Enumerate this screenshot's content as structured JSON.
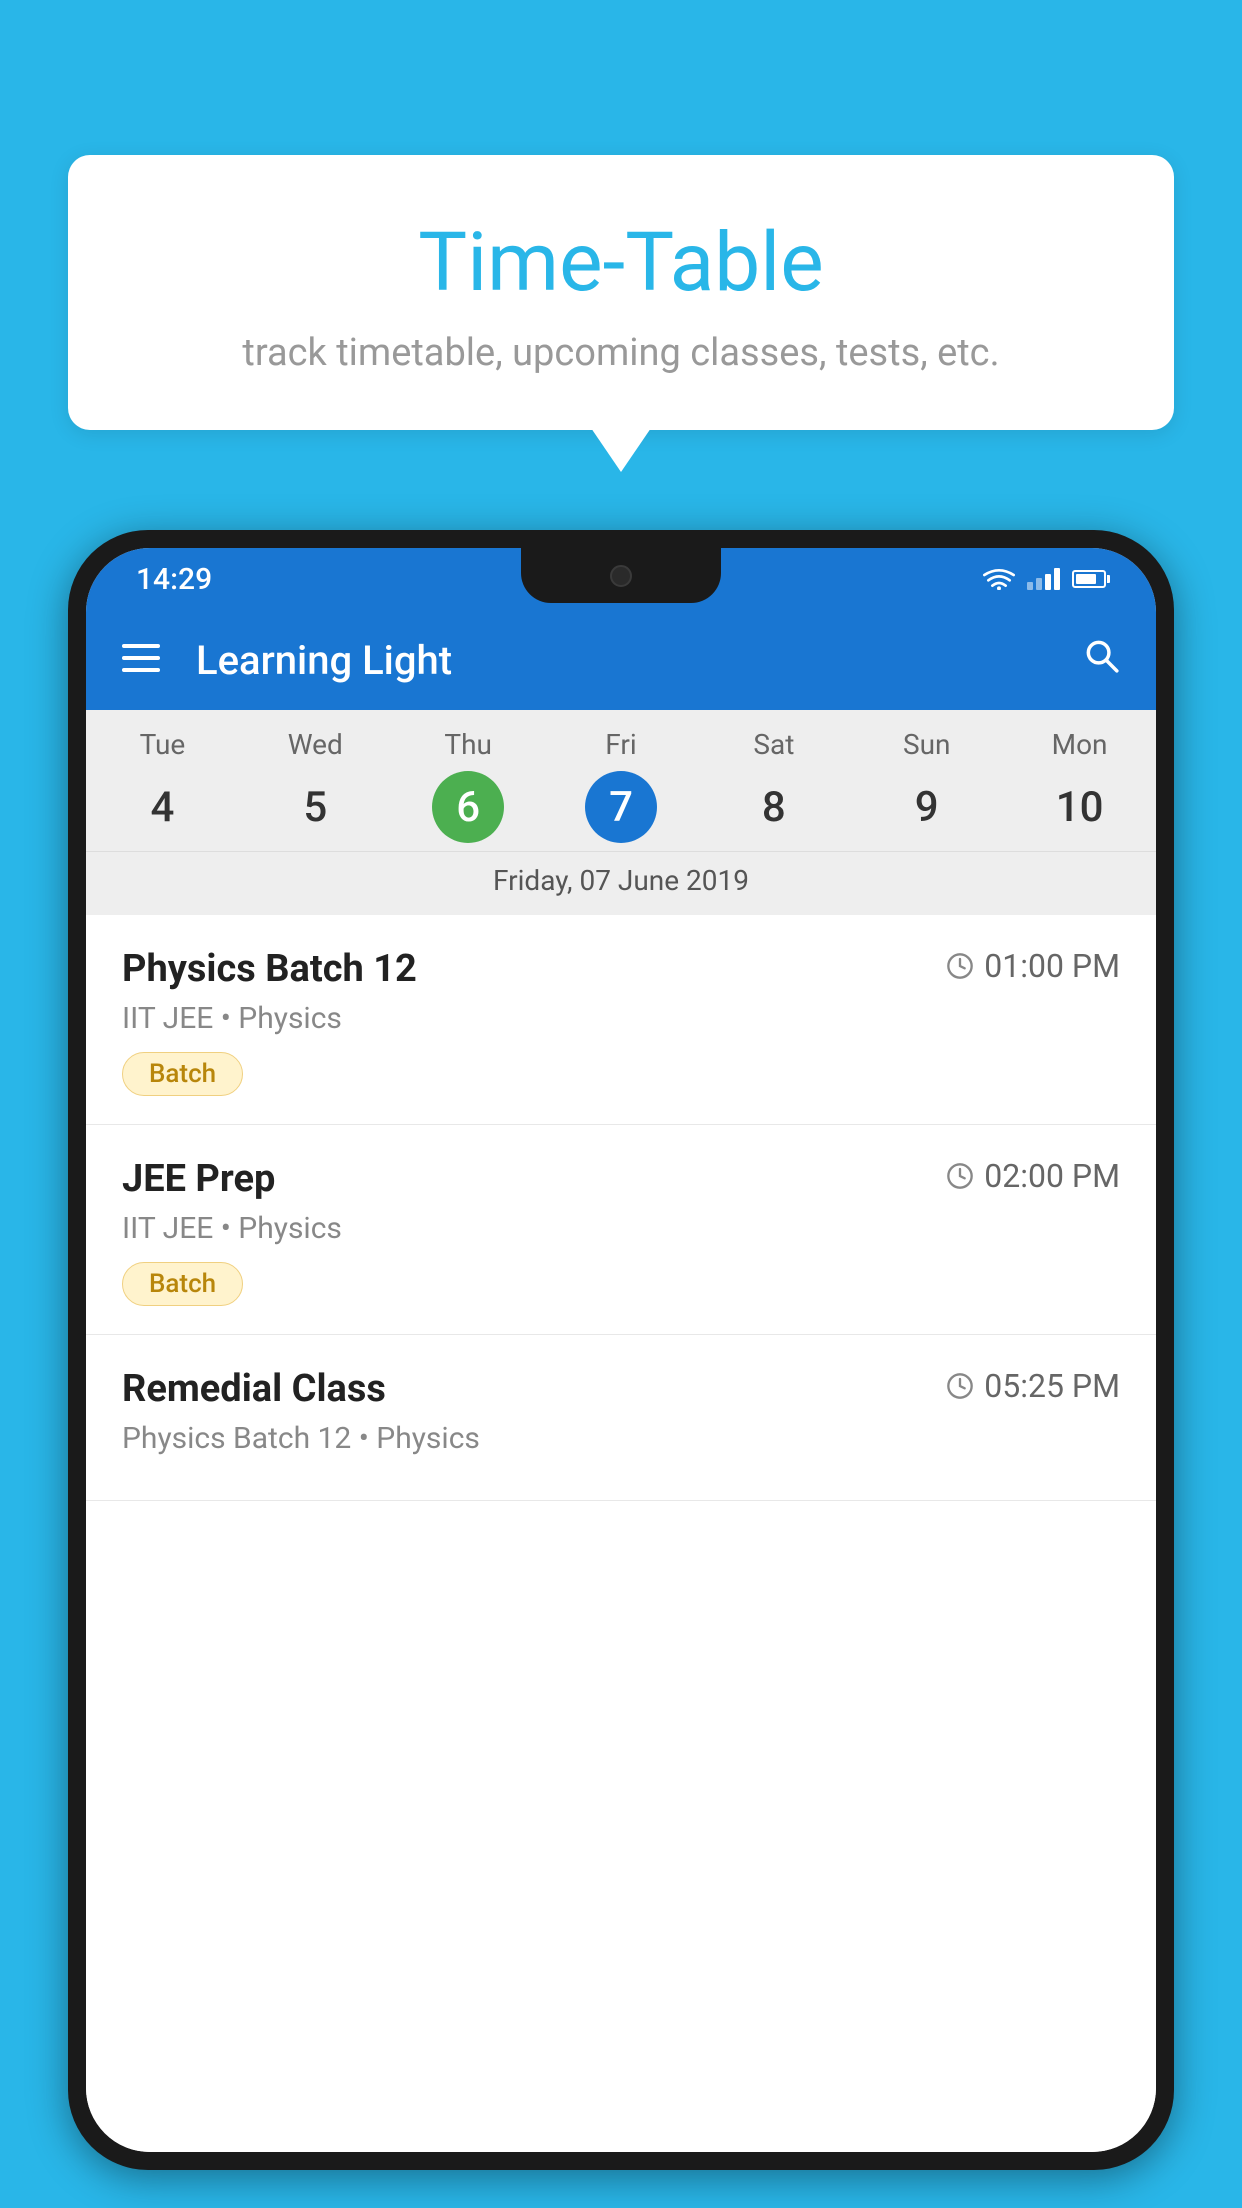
{
  "background_color": "#29b6e8",
  "bubble": {
    "title": "Time-Table",
    "subtitle": "track timetable, upcoming classes, tests, etc."
  },
  "phone": {
    "status_bar": {
      "time": "14:29",
      "wifi": true,
      "signal": true,
      "battery": true
    },
    "app_bar": {
      "title": "Learning Light",
      "hamburger_label": "≡",
      "search_label": "🔍"
    },
    "calendar": {
      "days": [
        {
          "name": "Tue",
          "number": "4",
          "state": "normal"
        },
        {
          "name": "Wed",
          "number": "5",
          "state": "normal"
        },
        {
          "name": "Thu",
          "number": "6",
          "state": "today"
        },
        {
          "name": "Fri",
          "number": "7",
          "state": "selected"
        },
        {
          "name": "Sat",
          "number": "8",
          "state": "normal"
        },
        {
          "name": "Sun",
          "number": "9",
          "state": "normal"
        },
        {
          "name": "Mon",
          "number": "10",
          "state": "normal"
        }
      ],
      "selected_date_label": "Friday, 07 June 2019"
    },
    "schedule": [
      {
        "title": "Physics Batch 12",
        "time": "01:00 PM",
        "subtitle": "IIT JEE • Physics",
        "badge": "Batch"
      },
      {
        "title": "JEE Prep",
        "time": "02:00 PM",
        "subtitle": "IIT JEE • Physics",
        "badge": "Batch"
      },
      {
        "title": "Remedial Class",
        "time": "05:25 PM",
        "subtitle": "Physics Batch 12 • Physics",
        "badge": null
      }
    ]
  }
}
